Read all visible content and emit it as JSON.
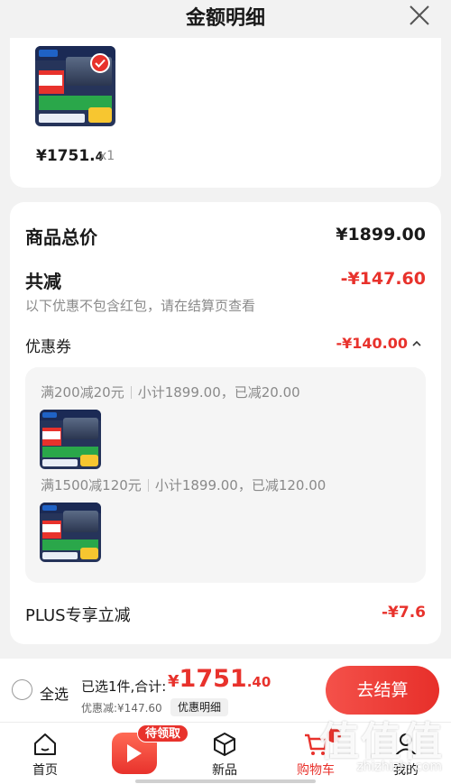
{
  "header": {
    "title": "金额明细"
  },
  "product": {
    "price_int": "¥1751.",
    "price_dec": "4",
    "qty": "x1"
  },
  "summary": {
    "total_label": "商品总价",
    "total_value": "¥1899.00",
    "reduce_label": "共减",
    "reduce_value": "-¥147.60",
    "note": "以下优惠不包含红包，请在结算页查看"
  },
  "coupon": {
    "label": "优惠券",
    "value": "-¥140.00",
    "items": [
      {
        "rule": "满200减20元",
        "detail": "小计1899.00，已减20.00"
      },
      {
        "rule": "满1500减120元",
        "detail": "小计1899.00，已减120.00"
      }
    ]
  },
  "plus": {
    "label": "PLUS专享立减",
    "value": "-¥7.6"
  },
  "bottom": {
    "select_all": "全选",
    "selected": "已选1件,合计:",
    "total_cur": "¥",
    "total_int": "1751",
    "total_dec": ".40",
    "discount": "优惠减:¥147.60",
    "detail_chip": "优惠明细",
    "checkout": "去结算"
  },
  "tabs": {
    "home": "首页",
    "promo_pill": "待领取",
    "new": "新品",
    "cart": "购物车",
    "me": "我的"
  },
  "watermark": {
    "big": "值值值",
    "small": "zhizhizhi.com"
  },
  "colors": {
    "accent": "#e8322c",
    "background": "#f2f2f2"
  }
}
